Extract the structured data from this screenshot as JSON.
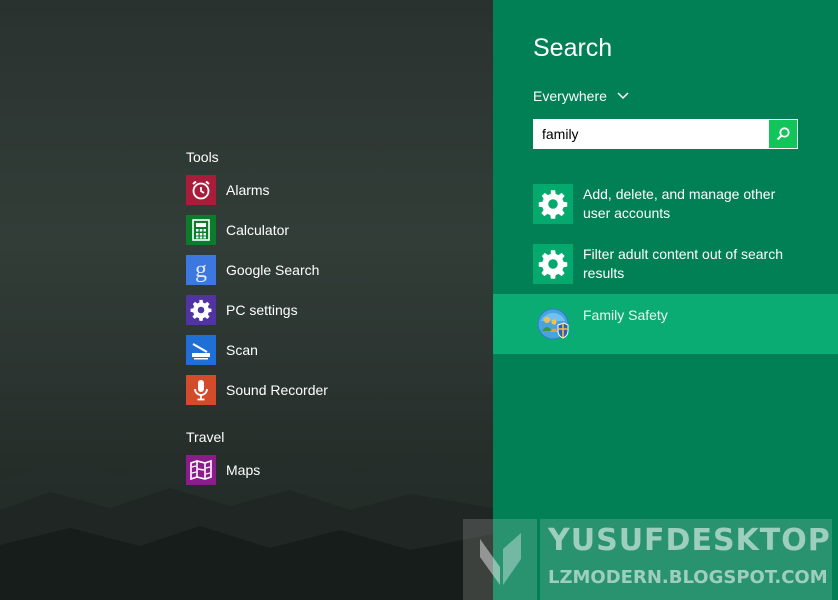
{
  "groups": {
    "tools_header": "Tools",
    "travel_header": "Travel"
  },
  "apps": {
    "alarms": {
      "label": "Alarms",
      "icon": "alarm-clock-icon",
      "color": "#a91d3a"
    },
    "calculator": {
      "label": "Calculator",
      "icon": "calculator-icon",
      "color": "#0a7c2c"
    },
    "google_search": {
      "label": "Google Search",
      "icon": "google-icon",
      "color": "#3d77e0"
    },
    "pc_settings": {
      "label": "PC settings",
      "icon": "gear-icon",
      "color": "#5233a3"
    },
    "scan": {
      "label": "Scan",
      "icon": "scanner-icon",
      "color": "#1f6fd6"
    },
    "sound_recorder": {
      "label": "Sound Recorder",
      "icon": "microphone-icon",
      "color": "#d24b2a"
    },
    "maps": {
      "label": "Maps",
      "icon": "map-icon",
      "color": "#8c1b8c"
    }
  },
  "search": {
    "title": "Search",
    "scope": "Everywhere",
    "query": "family",
    "results": [
      {
        "text": "Add, delete, and manage other user accounts",
        "icon": "gear-icon"
      },
      {
        "text": "Filter adult content out of search results",
        "icon": "gear-icon"
      },
      {
        "text": "Family Safety",
        "icon": "family-safety-icon",
        "selected": true
      }
    ]
  },
  "watermark": {
    "title": "YUSUFDESKTOP",
    "url": "LZMODERN.BLOGSPOT.COM"
  },
  "colors": {
    "pane": "#017f55",
    "selected_result": "#0bab74",
    "search_button": "#12c55a"
  }
}
